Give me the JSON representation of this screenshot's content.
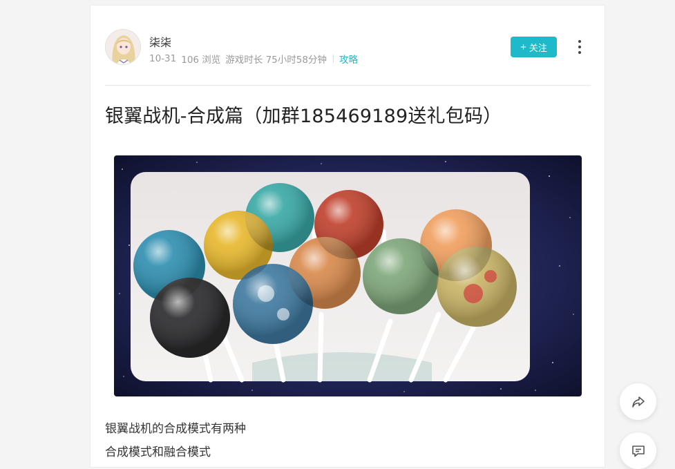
{
  "author": {
    "name": "柒柒",
    "date": "10-31",
    "views": "106 浏览",
    "playtime": "游戏时长 75小时58分钟",
    "tag": "攻略",
    "avatar_icon": "anime-girl-avatar"
  },
  "actions": {
    "follow_plus": "+",
    "follow_label": "关注",
    "more_icon": "vertical-dots-icon"
  },
  "post": {
    "title": "银翼战机-合成篇（加群185469189送礼包码）",
    "image_icon": "galaxy-lollipops-image",
    "paragraphs": [
      "银翼战机的合成模式有两种",
      "合成模式和融合模式"
    ]
  },
  "floating": {
    "share_icon": "share-icon",
    "comment_icon": "comment-icon"
  },
  "colors": {
    "accent": "#1fbac9",
    "tag": "#1fb5c9",
    "background": "#f4f4f4"
  }
}
